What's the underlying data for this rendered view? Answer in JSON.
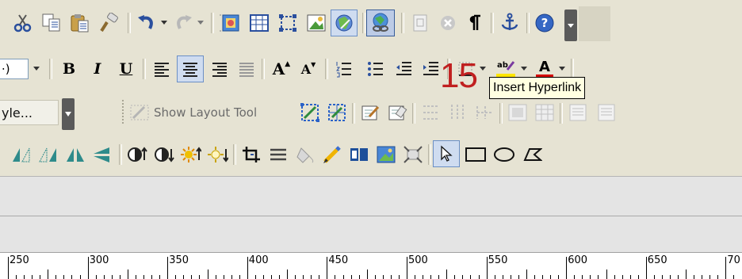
{
  "row2": {
    "partial_dropdown_text": "⋅)",
    "bold": "B",
    "italic": "I",
    "underline": "U",
    "grow_font": "A",
    "shrink_font": "A",
    "font_color_letter": "A"
  },
  "row3": {
    "style_dropdown_text": "yle...",
    "show_layout_tool": "Show Layout Tool"
  },
  "overlay": {
    "step_number": "15",
    "tooltip": "Insert Hyperlink"
  },
  "ruler": {
    "labels": [
      "250",
      "300",
      "350",
      "400",
      "450",
      "500",
      "550",
      "600",
      "650",
      "70"
    ]
  }
}
